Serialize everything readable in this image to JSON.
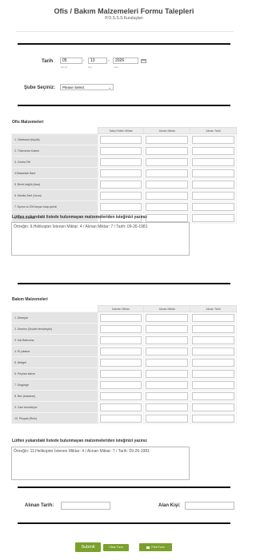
{
  "header": {
    "title": "Ofis / Bakım Malzemeleri Formu Talepleri",
    "subtitle": "P.O.S.S.S Kuruluşları"
  },
  "date": {
    "label": "Tarih",
    "month": "05",
    "day": "13",
    "year": "2026",
    "month_label": "Month",
    "day_label": "Day",
    "year_label": "Year",
    "separator": "-",
    "calendar_icon": "calendar-icon"
  },
  "branch": {
    "label": "Şube Seçiniz:",
    "selected": "Please Select"
  },
  "office": {
    "title": "Ofis Malzemeleri",
    "columns": [
      "Talep Edilen Miktar",
      "Alınan Miktar",
      "Alınan Tarih"
    ],
    "rows": [
      "1. Geleband (büyük)",
      "2. Tükenmez Kalem",
      "3. Zımba Teli",
      "4.Masaüstü Bant",
      "5. Bırrel kağıtlı (kısa)",
      "6. Manila Zarfı (Uzun)",
      "7. Eposn tv-200 beyaz tıraşı şeridi",
      "8. Genel Formlar"
    ]
  },
  "office_note": {
    "label": "Lütfen yukarıdaki listede bulunmayan malzemeleriden isteğinizi yazınız",
    "value": "Örneğin: 9.Helikopter İstenen Miktar: 4 / Alınan Miktar: 7 / Tarih: 09-26-1981"
  },
  "maintenance": {
    "title": "Bakım Malzemeleri",
    "columns": [
      "İstenen Miktar",
      "Alınan Miktar",
      "Alınan Tarih"
    ],
    "rows": [
      "1. Deterjan",
      "2. Domino (Sıvalet temizleyici)",
      "3. Kat Bahruma",
      "4. El yıkama",
      "5. Akisgel",
      "6. Peçhan kahve",
      "7. Dışgörge",
      "8. Bez (kaszban)",
      "9. Cam temizleyici",
      "10. Peçpas (Rulo)"
    ]
  },
  "maintenance_note": {
    "label": "Lütfen yukarıdaki listede bulunmayan malzemeleriden isteğinizi yazınız",
    "value": "Örneğin: 11.Helikopter  İstenen Miktar: 4 / Alınan Miktar: 7 / Tarih: 09-26-1981"
  },
  "footer_fields": {
    "received_date_label": "Alınan Tarih:",
    "receiver_label": "Alan Kişi:"
  },
  "buttons": {
    "submit": "Submit",
    "clear": "Clear Form",
    "print": "Print Form"
  },
  "colors": {
    "button_green": "#7aa12b"
  }
}
